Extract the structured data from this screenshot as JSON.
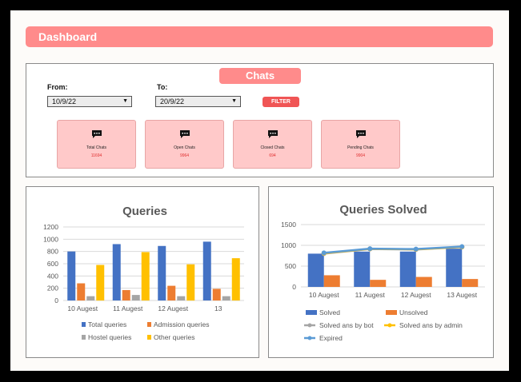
{
  "header": {
    "title": "Dashboard"
  },
  "chats": {
    "title": "Chats",
    "from_label": "From:",
    "from_value": "10/9/22",
    "to_label": "To:",
    "to_value": "20/9/22",
    "filter_label": "FILTER",
    "cards": [
      {
        "title": "Total Chats",
        "value": "11694",
        "icon": "chat-icon"
      },
      {
        "title": "Open Chats",
        "value": "9964",
        "icon": "chat-icon"
      },
      {
        "title": "Closed Chats",
        "value": "694",
        "icon": "chat-icon"
      },
      {
        "title": "Pending Chats",
        "value": "9904",
        "icon": "chat-icon"
      }
    ]
  },
  "chart_data": [
    {
      "type": "bar",
      "title": "Queries",
      "categories": [
        "10 Augest",
        "11 Augest",
        "12 Augest",
        "13"
      ],
      "ylim": [
        0,
        1200
      ],
      "yticks": [
        0,
        200,
        400,
        600,
        800,
        1000,
        1200
      ],
      "grid": true,
      "legend_position": "bottom",
      "series": [
        {
          "name": "Total queries",
          "color": "#4472c4",
          "values": [
            800,
            920,
            890,
            960
          ]
        },
        {
          "name": "Admission queries",
          "color": "#ed7d31",
          "values": [
            280,
            170,
            240,
            190
          ]
        },
        {
          "name": "Hostel queries",
          "color": "#a5a5a5",
          "values": [
            70,
            90,
            70,
            70
          ]
        },
        {
          "name": "Other queries",
          "color": "#ffc000",
          "values": [
            580,
            790,
            590,
            690
          ]
        }
      ]
    },
    {
      "type": "bar",
      "title": "Queries Solved",
      "categories": [
        "10 Augest",
        "11 Augest",
        "12 Augest",
        "13 Augest"
      ],
      "ylim": [
        0,
        1500
      ],
      "yticks": [
        0,
        500,
        1000,
        1500
      ],
      "grid": true,
      "legend_position": "bottom",
      "series": [
        {
          "name": "Solved",
          "kind": "bar",
          "color": "#4472c4",
          "values": [
            800,
            850,
            850,
            920
          ]
        },
        {
          "name": "Unsolved",
          "kind": "bar",
          "color": "#ed7d31",
          "values": [
            280,
            170,
            240,
            190
          ]
        },
        {
          "name": "Solved ans by bot",
          "kind": "line",
          "color": "#a5a5a5",
          "values": [
            800,
            910,
            900,
            960
          ]
        },
        {
          "name": "Solved ans by admin",
          "kind": "line",
          "color": "#ffc000",
          "values": [
            810,
            915,
            905,
            965
          ]
        },
        {
          "name": "Expired",
          "kind": "line",
          "color": "#5b9bd5",
          "values": [
            820,
            920,
            910,
            970
          ]
        }
      ]
    }
  ]
}
